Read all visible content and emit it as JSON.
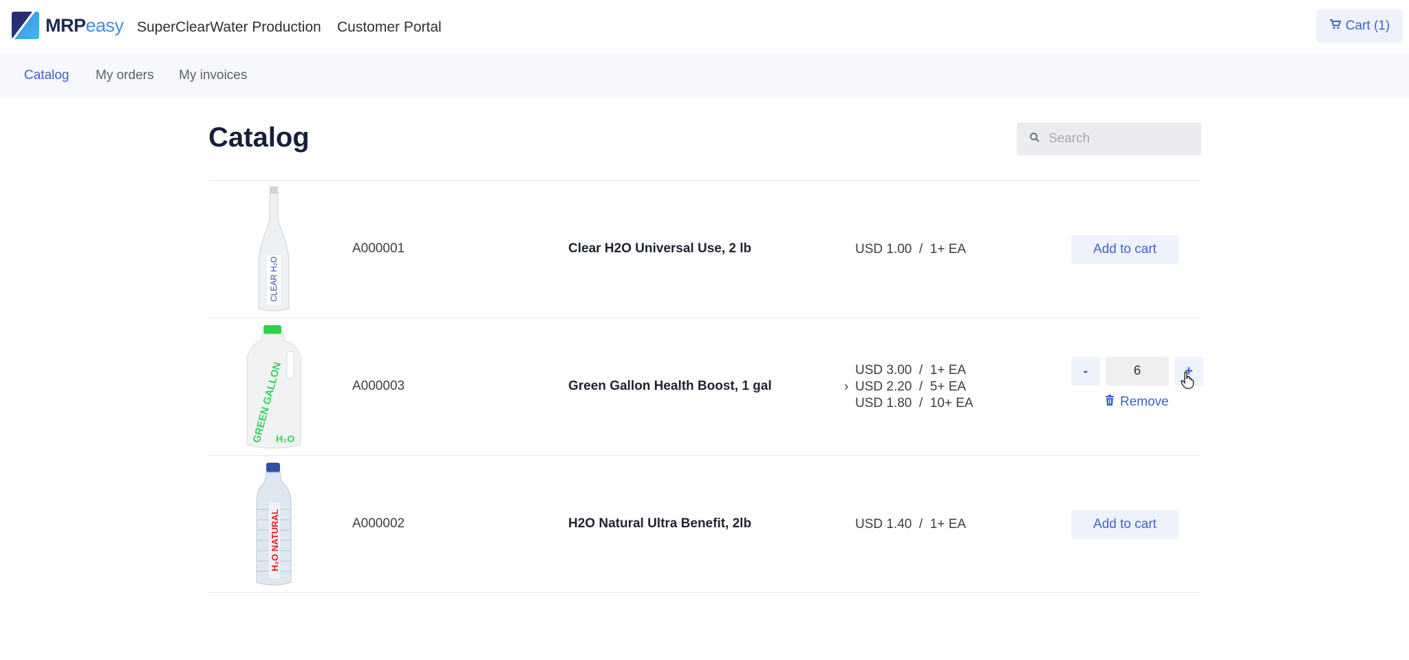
{
  "header": {
    "brand_bold": "MRP",
    "brand_light": "easy",
    "company": "SuperClearWater Production",
    "portal": "Customer Portal",
    "cart_label": "Cart (1)",
    "cart_icon": "cart-icon"
  },
  "nav": {
    "items": [
      {
        "label": "Catalog",
        "active": true
      },
      {
        "label": "My orders",
        "active": false
      },
      {
        "label": "My invoices",
        "active": false
      }
    ]
  },
  "main": {
    "title": "Catalog",
    "search": {
      "placeholder": "Search",
      "value": "",
      "icon": "search-icon"
    },
    "products": [
      {
        "code": "A000001",
        "name": "Clear H2O Universal Use, 2 lb",
        "image_label": "CLEAR H2O",
        "prices": [
          {
            "text": "USD 1.00  /  1+ EA",
            "selected": false
          }
        ],
        "action": "Add to cart"
      },
      {
        "code": "A000003",
        "name": "Green Gallon Health Boost, 1 gal",
        "image_label": "GREEN GALLON",
        "image_sublabel": "H2O",
        "prices": [
          {
            "text": "USD 3.00  /  1+ EA",
            "selected": false
          },
          {
            "text": "USD 2.20  /  5+ EA",
            "selected": true
          },
          {
            "text": "USD 1.80  /  10+ EA",
            "selected": false
          }
        ],
        "quantity": "6",
        "minus_label": "-",
        "plus_label": "+",
        "remove_label": "Remove"
      },
      {
        "code": "A000002",
        "name": "H2O Natural Ultra Benefit, 2lb",
        "image_label": "H2O NATURAL",
        "prices": [
          {
            "text": "USD 1.40  /  1+ EA",
            "selected": false
          }
        ],
        "action": "Add to cart"
      }
    ]
  },
  "colors": {
    "accent": "#3d63c7",
    "button_bg": "#eef2fc",
    "nav_bg": "#f7f8fb"
  }
}
